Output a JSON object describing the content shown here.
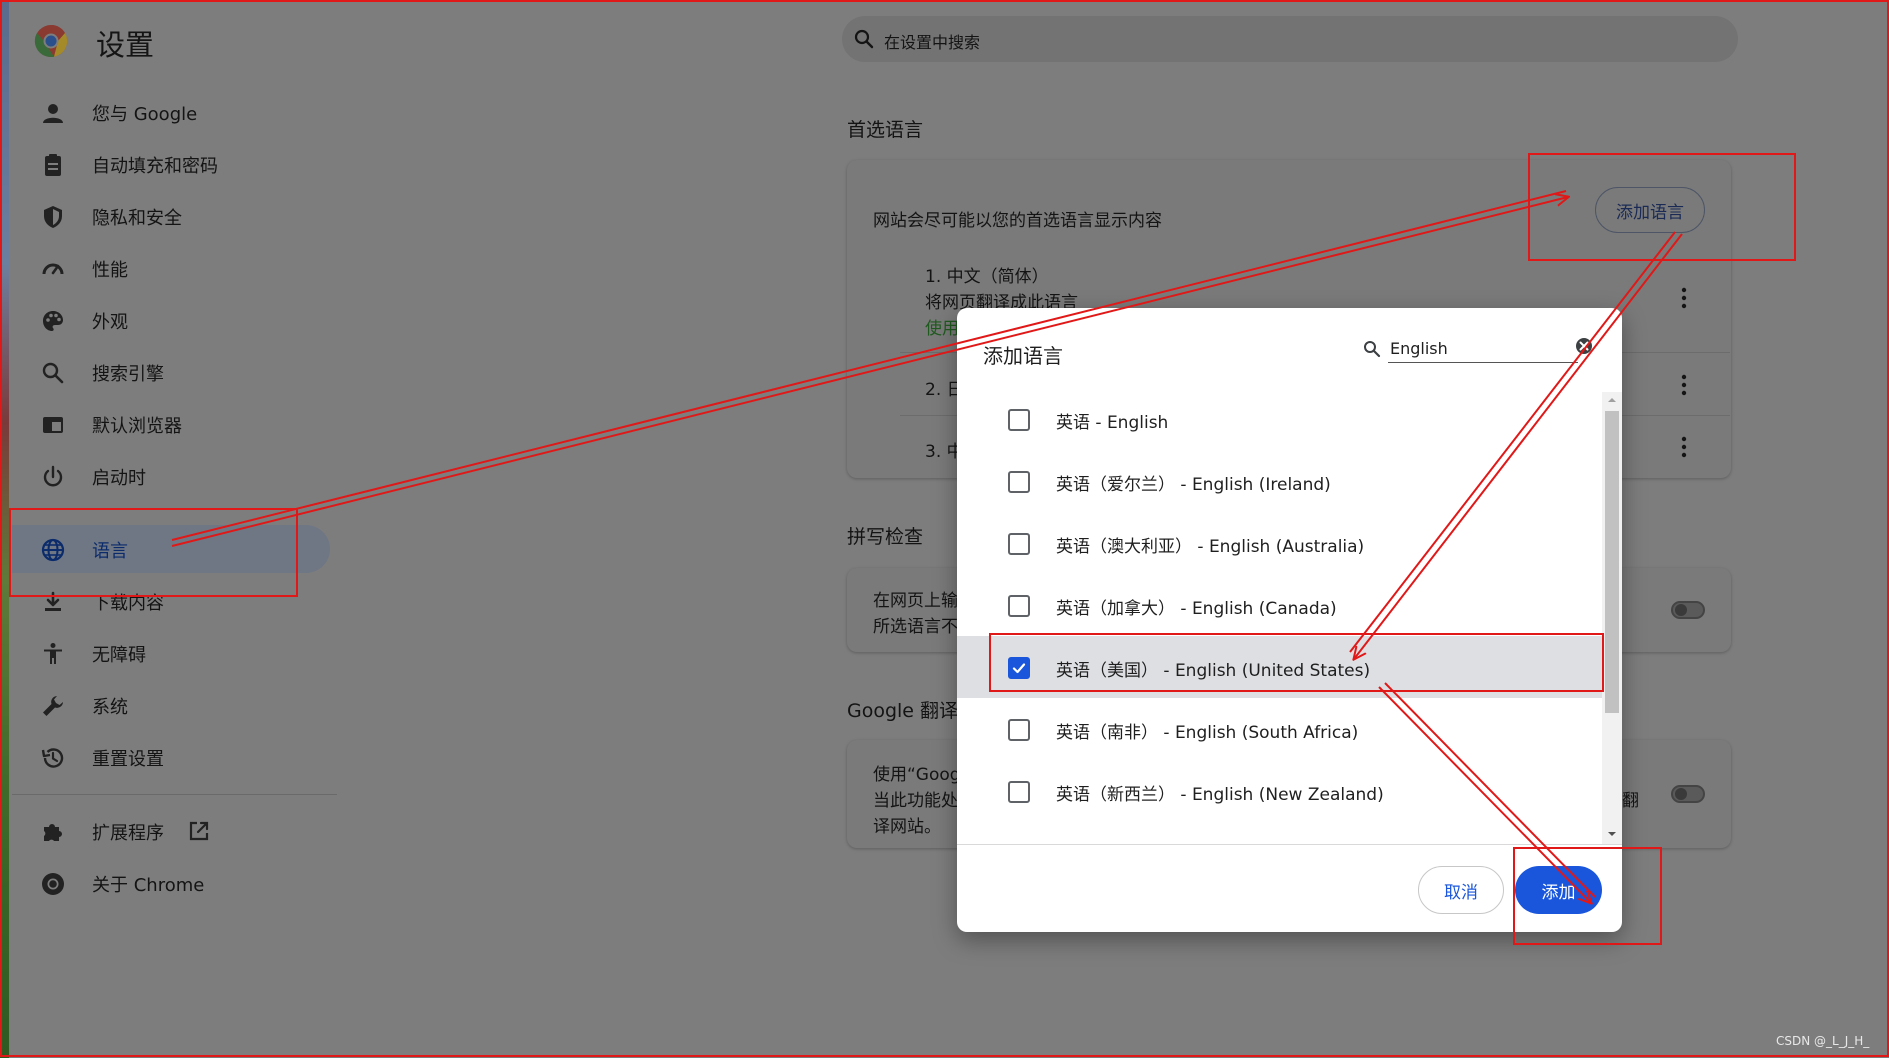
{
  "header": {
    "title": "设置",
    "search_placeholder": "在设置中搜索"
  },
  "sidebar": {
    "items": [
      {
        "label": "您与 Google",
        "icon": "person-icon"
      },
      {
        "label": "自动填充和密码",
        "icon": "clipboard-icon"
      },
      {
        "label": "隐私和安全",
        "icon": "shield-icon"
      },
      {
        "label": "性能",
        "icon": "speedometer-icon"
      },
      {
        "label": "外观",
        "icon": "palette-icon"
      },
      {
        "label": "搜索引擎",
        "icon": "search-icon"
      },
      {
        "label": "默认浏览器",
        "icon": "browser-window-icon"
      },
      {
        "label": "启动时",
        "icon": "power-icon"
      },
      {
        "label": "语言",
        "icon": "globe-icon",
        "active": true
      },
      {
        "label": "下载内容",
        "icon": "download-icon"
      },
      {
        "label": "无障碍",
        "icon": "accessibility-icon"
      },
      {
        "label": "系统",
        "icon": "wrench-icon"
      },
      {
        "label": "重置设置",
        "icon": "history-icon"
      },
      {
        "label": "扩展程序",
        "icon": "puzzle-icon",
        "external_icon": "open-in-new-icon"
      },
      {
        "label": "关于 Chrome",
        "icon": "chrome-icon"
      }
    ]
  },
  "main": {
    "preferred_languages": {
      "title": "首选语言",
      "description": "网站会尽可能以您的首选语言显示内容",
      "add_button_label": "添加语言",
      "languages": [
        {
          "name": "1. 中文（简体）",
          "sub1": "将网页翻译成此语言",
          "sub2": "使用"
        },
        {
          "name": "2. 日"
        },
        {
          "name": "3. 中"
        }
      ]
    },
    "spellcheck": {
      "title": "拼写检查",
      "line1": "在网页上输",
      "line2": "所选语言不"
    },
    "google_translate": {
      "title": "Google 翻译",
      "line1": "使用“Goog",
      "line2": "当此功能处",
      "line3": "译网站。",
      "right_fragment": "翻"
    }
  },
  "dialog": {
    "title": "添加语言",
    "search_value": "English",
    "languages": [
      {
        "label": "英语 - English",
        "checked": false
      },
      {
        "label": "英语（爱尔兰） - English (Ireland)",
        "checked": false
      },
      {
        "label": "英语（澳大利亚） - English (Australia)",
        "checked": false
      },
      {
        "label": "英语（加拿大） - English (Canada)",
        "checked": false
      },
      {
        "label": "英语（美国） - English (United States)",
        "checked": true
      },
      {
        "label": "英语（南非） - English (South Africa)",
        "checked": false
      },
      {
        "label": "英语（新西兰） - English (New Zealand)",
        "checked": false
      }
    ],
    "cancel_label": "取消",
    "add_label": "添加"
  },
  "watermark": "CSDN @_L_J_H_",
  "colors": {
    "accent": "#1a56db",
    "annotation": "#e01818"
  }
}
